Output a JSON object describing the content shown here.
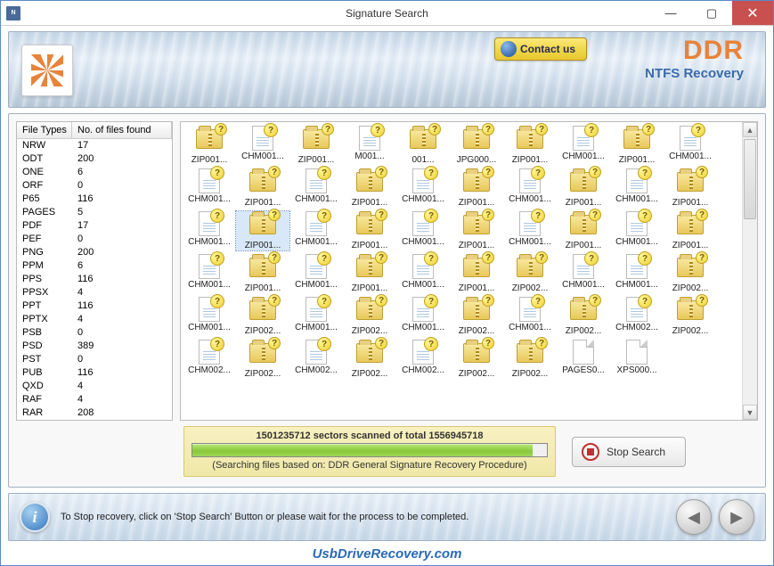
{
  "window": {
    "title": "Signature Search"
  },
  "header": {
    "contact_label": "Contact us",
    "brand": "DDR",
    "brand_sub": "NTFS Recovery"
  },
  "table": {
    "col1": "File Types",
    "col2": "No. of files found",
    "rows": [
      {
        "type": "NRW",
        "count": "17"
      },
      {
        "type": "ODT",
        "count": "200"
      },
      {
        "type": "ONE",
        "count": "6"
      },
      {
        "type": "ORF",
        "count": "0"
      },
      {
        "type": "P65",
        "count": "116"
      },
      {
        "type": "PAGES",
        "count": "5"
      },
      {
        "type": "PDF",
        "count": "17"
      },
      {
        "type": "PEF",
        "count": "0"
      },
      {
        "type": "PNG",
        "count": "200"
      },
      {
        "type": "PPM",
        "count": "6"
      },
      {
        "type": "PPS",
        "count": "116"
      },
      {
        "type": "PPSX",
        "count": "4"
      },
      {
        "type": "PPT",
        "count": "116"
      },
      {
        "type": "PPTX",
        "count": "4"
      },
      {
        "type": "PSB",
        "count": "0"
      },
      {
        "type": "PSD",
        "count": "389"
      },
      {
        "type": "PST",
        "count": "0"
      },
      {
        "type": "PUB",
        "count": "116"
      },
      {
        "type": "QXD",
        "count": "4"
      },
      {
        "type": "RAF",
        "count": "4"
      },
      {
        "type": "RAR",
        "count": "208"
      }
    ]
  },
  "grid": {
    "rows": [
      [
        {
          "label": "ZIP001...",
          "kind": "zip"
        },
        {
          "label": "CHM001...",
          "kind": "chm"
        },
        {
          "label": "ZIP001...",
          "kind": "zip"
        },
        {
          "label": "M001...",
          "kind": "chm"
        },
        {
          "label": "001...",
          "kind": "zip"
        },
        {
          "label": "JPG000...",
          "kind": "zip"
        },
        {
          "label": "ZIP001...",
          "kind": "zip"
        },
        {
          "label": "CHM001...",
          "kind": "chm"
        },
        {
          "label": "ZIP001...",
          "kind": "zip"
        },
        {
          "label": "CHM001...",
          "kind": "chm"
        }
      ],
      [
        {
          "label": "CHM001...",
          "kind": "chm"
        },
        {
          "label": "ZIP001...",
          "kind": "zip"
        },
        {
          "label": "CHM001...",
          "kind": "chm"
        },
        {
          "label": "ZIP001...",
          "kind": "zip"
        },
        {
          "label": "CHM001...",
          "kind": "chm"
        },
        {
          "label": "ZIP001...",
          "kind": "zip"
        },
        {
          "label": "CHM001...",
          "kind": "chm"
        },
        {
          "label": "ZIP001...",
          "kind": "zip"
        },
        {
          "label": "CHM001...",
          "kind": "chm"
        },
        {
          "label": "ZIP001...",
          "kind": "zip"
        }
      ],
      [
        {
          "label": "CHM001...",
          "kind": "chm"
        },
        {
          "label": "ZIP001...",
          "kind": "zip",
          "sel": true
        },
        {
          "label": "CHM001...",
          "kind": "chm"
        },
        {
          "label": "ZIP001...",
          "kind": "zip"
        },
        {
          "label": "CHM001...",
          "kind": "chm"
        },
        {
          "label": "ZIP001...",
          "kind": "zip"
        },
        {
          "label": "CHM001...",
          "kind": "chm"
        },
        {
          "label": "ZIP001...",
          "kind": "zip"
        },
        {
          "label": "CHM001...",
          "kind": "chm"
        },
        {
          "label": "ZIP001...",
          "kind": "zip"
        }
      ],
      [
        {
          "label": "CHM001...",
          "kind": "chm"
        },
        {
          "label": "ZIP001...",
          "kind": "zip"
        },
        {
          "label": "CHM001...",
          "kind": "chm"
        },
        {
          "label": "ZIP001...",
          "kind": "zip"
        },
        {
          "label": "CHM001...",
          "kind": "chm"
        },
        {
          "label": "ZIP001...",
          "kind": "zip"
        },
        {
          "label": "ZIP002...",
          "kind": "zip"
        },
        {
          "label": "CHM001...",
          "kind": "chm"
        },
        {
          "label": "CHM001...",
          "kind": "chm"
        },
        {
          "label": "ZIP002...",
          "kind": "zip"
        }
      ],
      [
        {
          "label": "CHM001...",
          "kind": "chm"
        },
        {
          "label": "ZIP002...",
          "kind": "zip"
        },
        {
          "label": "CHM001...",
          "kind": "chm"
        },
        {
          "label": "ZIP002...",
          "kind": "zip"
        },
        {
          "label": "CHM001...",
          "kind": "chm"
        },
        {
          "label": "ZIP002...",
          "kind": "zip"
        },
        {
          "label": "CHM001...",
          "kind": "chm"
        },
        {
          "label": "ZIP002...",
          "kind": "zip"
        },
        {
          "label": "CHM002...",
          "kind": "chm"
        },
        {
          "label": "ZIP002...",
          "kind": "zip"
        }
      ],
      [
        {
          "label": "CHM002...",
          "kind": "chm"
        },
        {
          "label": "ZIP002...",
          "kind": "zip"
        },
        {
          "label": "CHM002...",
          "kind": "chm"
        },
        {
          "label": "ZIP002...",
          "kind": "zip"
        },
        {
          "label": "CHM002...",
          "kind": "chm"
        },
        {
          "label": "ZIP002...",
          "kind": "zip"
        },
        {
          "label": "ZIP002...",
          "kind": "zip"
        },
        {
          "label": "PAGES0...",
          "kind": "page"
        },
        {
          "label": "XPS000...",
          "kind": "page"
        },
        {
          "label": "",
          "kind": "none"
        }
      ]
    ]
  },
  "progress": {
    "text": "1501235712 sectors scanned of total 1556945718",
    "percent": 96,
    "sub": "(Searching files based on:  DDR General Signature Recovery Procedure)"
  },
  "stop_label": "Stop Search",
  "footer": {
    "text": "To Stop recovery, click on 'Stop Search' Button or please wait for the process to be completed."
  },
  "watermark": "UsbDriveRecovery.com"
}
